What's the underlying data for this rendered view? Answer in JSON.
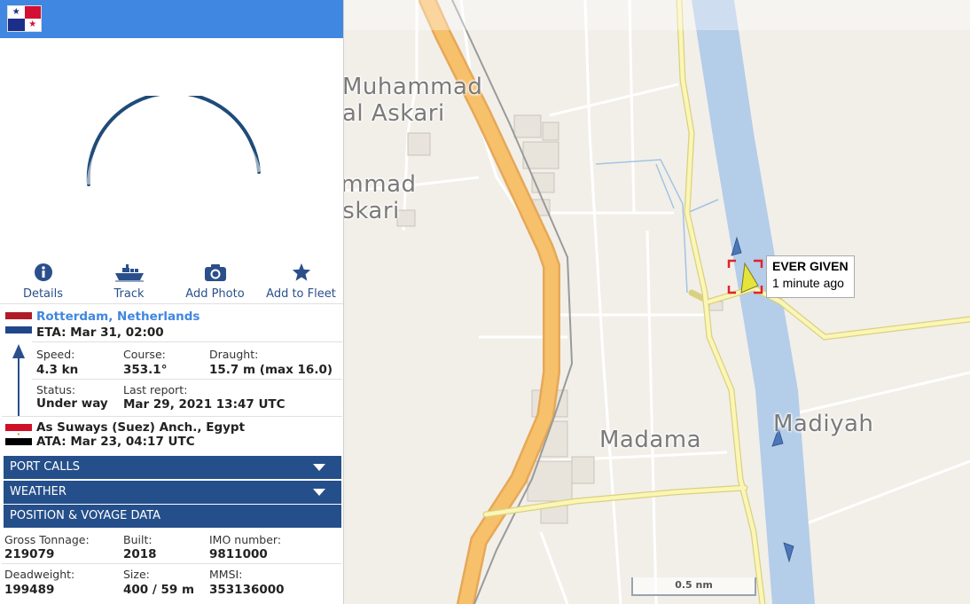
{
  "map": {
    "places": [
      "Muhammad al Askari",
      "ammad Askari",
      "Madama",
      "Madiyah"
    ],
    "ship_label": {
      "name": "EVER GIVEN",
      "ago": "1 minute ago"
    },
    "scale": "0.5 nm",
    "colors": {
      "canal": "#b4cde9",
      "land": "#f2efe9",
      "highway": "#f5b860",
      "road": "#fbf5b6",
      "ship_selected": "#e4e43a",
      "ship_other": "#4b76b8",
      "select_box": "#e0232b"
    }
  },
  "panel": {
    "header": {
      "flag": "panama-flag",
      "color": "#3f87e0"
    },
    "actions": [
      {
        "label": "Details",
        "icon": "info-icon"
      },
      {
        "label": "Track",
        "icon": "ship-icon"
      },
      {
        "label": "Add Photo",
        "icon": "camera-icon"
      },
      {
        "label": "Add to Fleet",
        "icon": "star-icon"
      }
    ],
    "destination": {
      "name": "Rotterdam, Netherlands",
      "eta": "ETA: Mar 31, 02:00"
    },
    "fields": {
      "speed_label": "Speed:",
      "speed": "4.3 kn",
      "course_label": "Course:",
      "course": "353.1°",
      "draught_label": "Draught:",
      "draught": "15.7 m (max 16.0)",
      "status_label": "Status:",
      "status": "Under way",
      "last_report_label": "Last report:",
      "last_report": "Mar 29, 2021 13:47 UTC"
    },
    "origin": {
      "name": "As Suways (Suez) Anch., Egypt",
      "ata": "ATA: Mar 23, 04:17 UTC"
    },
    "sections": [
      "PORT CALLS",
      "WEATHER",
      "POSITION & VOYAGE DATA"
    ],
    "vessel": {
      "gross_tonnage_label": "Gross Tonnage:",
      "gross_tonnage": "219079",
      "built_label": "Built:",
      "built": "2018",
      "imo_label": "IMO number:",
      "imo": "9811000",
      "deadweight_label": "Deadweight:",
      "deadweight": "199489",
      "size_label": "Size:",
      "size": "400 / 59 m",
      "mmsi_label": "MMSI:",
      "mmsi": "353136000"
    }
  }
}
